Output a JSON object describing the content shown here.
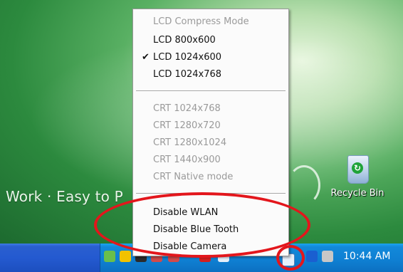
{
  "desktop": {
    "background_text": "Work · Easy to P",
    "recycle_bin_label": "Recycle Bin"
  },
  "context_menu": {
    "items": [
      {
        "label": "LCD Compress Mode",
        "enabled": false,
        "checked": false
      },
      {
        "label": "LCD 800x600",
        "enabled": true,
        "checked": false
      },
      {
        "label": "LCD 1024x600",
        "enabled": true,
        "checked": true
      },
      {
        "label": "LCD 1024x768",
        "enabled": true,
        "checked": false
      },
      {
        "label": "CRT 1024x768",
        "enabled": false,
        "checked": false
      },
      {
        "label": "CRT 1280x720",
        "enabled": false,
        "checked": false
      },
      {
        "label": "CRT 1280x1024",
        "enabled": false,
        "checked": false
      },
      {
        "label": "CRT 1440x900",
        "enabled": false,
        "checked": false
      },
      {
        "label": "CRT Native mode",
        "enabled": false,
        "checked": false
      },
      {
        "label": "Disable WLAN",
        "enabled": true,
        "checked": false
      },
      {
        "label": "Disable Blue Tooth",
        "enabled": true,
        "checked": false
      },
      {
        "label": "Disable Camera",
        "enabled": true,
        "checked": false
      }
    ],
    "check_glyph": "✔"
  },
  "taskbar": {
    "clock": "10:44 AM",
    "tray_icons": [
      "network-icon",
      "shield-icon",
      "volume-icon",
      "network-disabled-icon",
      "network-disabled-icon",
      "battery-icon",
      "arrow-icon",
      "utility-tray-icon",
      "bluetooth-icon",
      "display-icon"
    ]
  },
  "colors": {
    "highlight_annotation": "#e3161c",
    "taskbar_blue": "#245ad0",
    "tray_blue": "#0f7fd2",
    "disabled_text": "#9a9a9a"
  }
}
